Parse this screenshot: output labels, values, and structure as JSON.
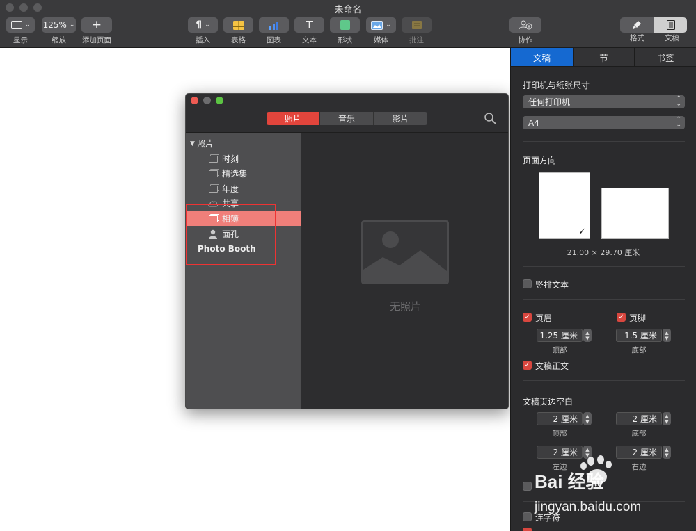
{
  "window": {
    "title": "未命名"
  },
  "toolbar": {
    "view": {
      "label": "显示",
      "icon": "sidebar-icon"
    },
    "zoom": {
      "value": "125%",
      "label": "缩放"
    },
    "add_page": {
      "label": "添加页面"
    },
    "insert": {
      "label": "插入"
    },
    "table": {
      "label": "表格"
    },
    "chart": {
      "label": "图表"
    },
    "text": {
      "label": "文本"
    },
    "shape": {
      "label": "形状"
    },
    "media": {
      "label": "媒体"
    },
    "comment": {
      "label": "批注"
    },
    "collaborate": {
      "label": "协作"
    },
    "format": {
      "label": "格式"
    },
    "document": {
      "label": "文稿"
    }
  },
  "media_browser": {
    "tabs": [
      {
        "label": "照片",
        "active": true
      },
      {
        "label": "音乐",
        "active": false
      },
      {
        "label": "影片",
        "active": false
      }
    ],
    "sidebar": {
      "section": "照片",
      "items": [
        {
          "label": "时刻",
          "icon": "library-icon"
        },
        {
          "label": "精选集",
          "icon": "library-icon"
        },
        {
          "label": "年度",
          "icon": "library-icon"
        },
        {
          "label": "共享",
          "icon": "cloud-icon"
        },
        {
          "label": "相簿",
          "icon": "library-icon",
          "selected": true
        },
        {
          "label": "面孔",
          "icon": "person-icon"
        }
      ],
      "extra": "Photo Booth"
    },
    "empty_text": "无照片"
  },
  "inspector": {
    "tabs": [
      {
        "label": "文稿",
        "active": true
      },
      {
        "label": "节",
        "active": false
      },
      {
        "label": "书签",
        "active": false
      }
    ],
    "printer_section": "打印机与纸张尺寸",
    "printer": "任何打印机",
    "paper": "A4",
    "orientation_label": "页面方向",
    "orientation": "portrait",
    "dimensions": "21.00 × 29.70 厘米",
    "vertical_text": {
      "label": "竖排文本",
      "checked": false
    },
    "header": {
      "label": "页眉",
      "checked": true,
      "value": "1.25 厘米",
      "sublabel": "顶部"
    },
    "footer": {
      "label": "页脚",
      "checked": true,
      "value": "1.5 厘米",
      "sublabel": "底部"
    },
    "body": {
      "label": "文稿正文",
      "checked": true
    },
    "margins_label": "文稿页边空白",
    "margins": {
      "top": {
        "value": "2 厘米",
        "label": "顶部"
      },
      "bottom": {
        "value": "2 厘米",
        "label": "底部"
      },
      "left": {
        "value": "2 厘米",
        "label": "左边"
      },
      "right": {
        "value": "2 厘米",
        "label": "右边"
      }
    },
    "hyphenation": {
      "label": "连字符",
      "checked": false
    }
  },
  "watermark": {
    "brand": "Bai 经验",
    "url": "jingyan.baidu.com"
  },
  "colors": {
    "accent_red": "#e2453c",
    "inspector_blue": "#1569d1",
    "checkbox_red": "#d9473f"
  }
}
